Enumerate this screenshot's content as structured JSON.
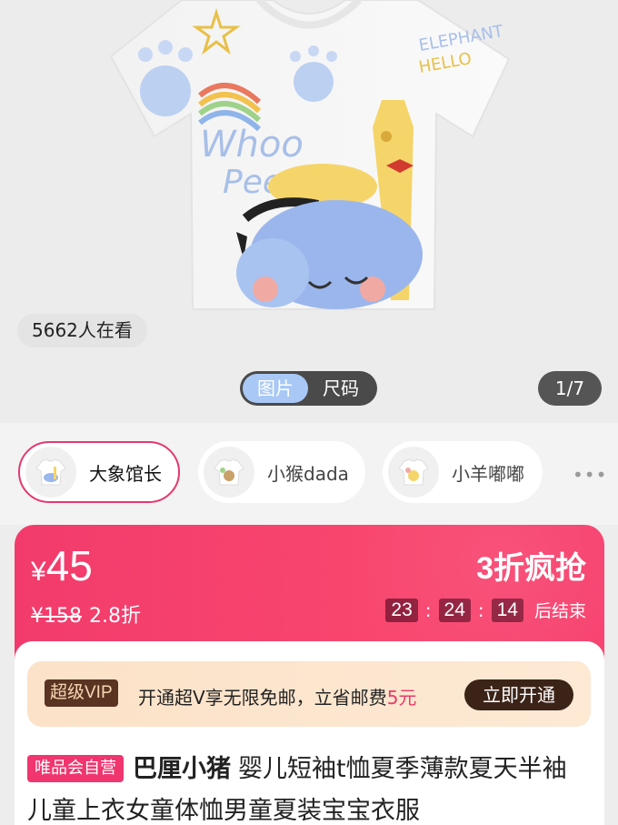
{
  "hero": {
    "viewers": "5662人在看",
    "toggle": {
      "options": [
        "图片",
        "尺码"
      ],
      "active": "图片"
    },
    "page_counter": "1/7"
  },
  "variants": {
    "items": [
      {
        "label": "大象馆长",
        "selected": true
      },
      {
        "label": "小猴dada",
        "selected": false
      },
      {
        "label": "小羊嘟嘟",
        "selected": false
      }
    ],
    "more": "•••"
  },
  "price": {
    "symbol": "¥",
    "current": "45",
    "original": "¥158",
    "discount": "2.8折",
    "promo_title": "3折疯抢",
    "countdown": {
      "h": "23",
      "m": "24",
      "s": "14",
      "suffix": "后结束"
    },
    "accent": "#f23b6c"
  },
  "vip": {
    "badge": "超级VIP",
    "text_pre": "开通超V享无限免邮，立省邮费",
    "text_amount": "5元",
    "button": "立即开通"
  },
  "product": {
    "tag": "唯品会自营",
    "brand": "巴厘小猪",
    "title": "婴儿短袖t恤夏季薄款夏天半袖儿童上衣女童体恤男童夏装宝宝衣服"
  }
}
